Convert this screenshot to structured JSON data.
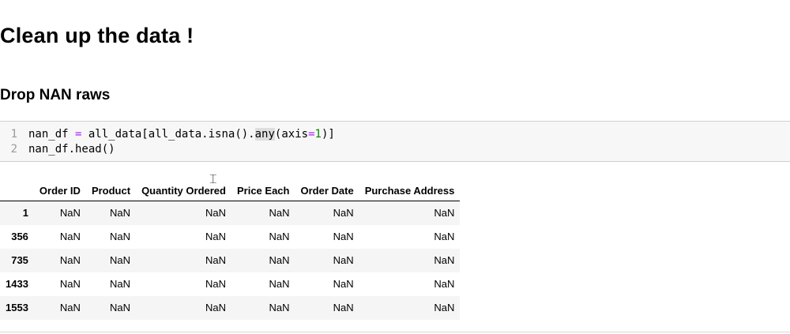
{
  "notebook": {
    "title": "Clean up the data !",
    "subtitle": "Drop NAN raws"
  },
  "code_cell": {
    "lines": [
      {
        "number": "1",
        "text_a": "nan_df ",
        "eq": "=",
        "text_b": " all_data[all_data.isna().",
        "hl": "any",
        "text_c": "(axis",
        "eq2": "=",
        "num": "1",
        "text_d": ")]"
      },
      {
        "number": "2",
        "text": "nan_df.head()"
      }
    ]
  },
  "output_table": {
    "columns": [
      "",
      "Order ID",
      "Product",
      "Quantity Ordered",
      "Price Each",
      "Order Date",
      "Purchase Address"
    ],
    "rows": [
      {
        "index": "1",
        "cells": [
          "NaN",
          "NaN",
          "NaN",
          "NaN",
          "NaN",
          "NaN"
        ]
      },
      {
        "index": "356",
        "cells": [
          "NaN",
          "NaN",
          "NaN",
          "NaN",
          "NaN",
          "NaN"
        ]
      },
      {
        "index": "735",
        "cells": [
          "NaN",
          "NaN",
          "NaN",
          "NaN",
          "NaN",
          "NaN"
        ]
      },
      {
        "index": "1433",
        "cells": [
          "NaN",
          "NaN",
          "NaN",
          "NaN",
          "NaN",
          "NaN"
        ]
      },
      {
        "index": "1553",
        "cells": [
          "NaN",
          "NaN",
          "NaN",
          "NaN",
          "NaN",
          "NaN"
        ]
      }
    ]
  },
  "icons": {
    "cursor": "text-cursor-icon"
  },
  "colors": {
    "code_background": "#f7f7f7",
    "operator": "#aa22ff",
    "number": "#008800",
    "row_stripe": "#f5f5f5"
  }
}
